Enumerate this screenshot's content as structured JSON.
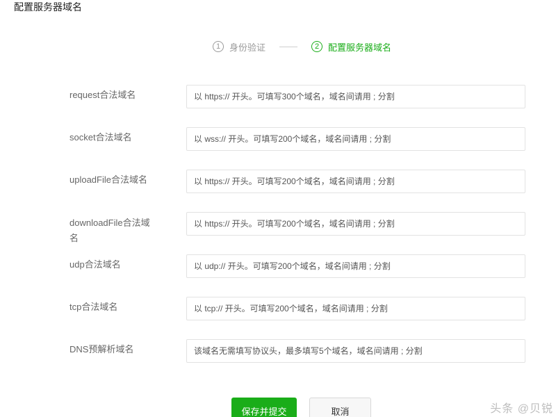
{
  "page": {
    "title": "配置服务器域名"
  },
  "steps": [
    {
      "num": "1",
      "label": "身份验证",
      "active": false
    },
    {
      "num": "2",
      "label": "配置服务器域名",
      "active": true
    }
  ],
  "form": {
    "rows": [
      {
        "label": "request合法域名",
        "placeholder": "以 https:// 开头。可填写300个域名，域名间请用 ; 分割"
      },
      {
        "label": "socket合法域名",
        "placeholder": "以 wss:// 开头。可填写200个域名，域名间请用 ; 分割"
      },
      {
        "label": "uploadFile合法域名",
        "placeholder": "以 https:// 开头。可填写200个域名，域名间请用 ; 分割"
      },
      {
        "label": "downloadFile合法域名",
        "placeholder": "以 https:// 开头。可填写200个域名，域名间请用 ; 分割"
      },
      {
        "label": "udp合法域名",
        "placeholder": "以 udp:// 开头。可填写200个域名，域名间请用 ; 分割"
      },
      {
        "label": "tcp合法域名",
        "placeholder": "以 tcp:// 开头。可填写200个域名，域名间请用 ; 分割"
      },
      {
        "label": "DNS预解析域名",
        "placeholder": "该域名无需填写协议头，最多填写5个域名，域名间请用 ; 分割"
      }
    ]
  },
  "actions": {
    "save_label": "保存并提交",
    "cancel_label": "取消"
  },
  "watermark": "头条 @贝锐",
  "colors": {
    "accent": "#1aad19",
    "muted": "#9a9a9a"
  }
}
